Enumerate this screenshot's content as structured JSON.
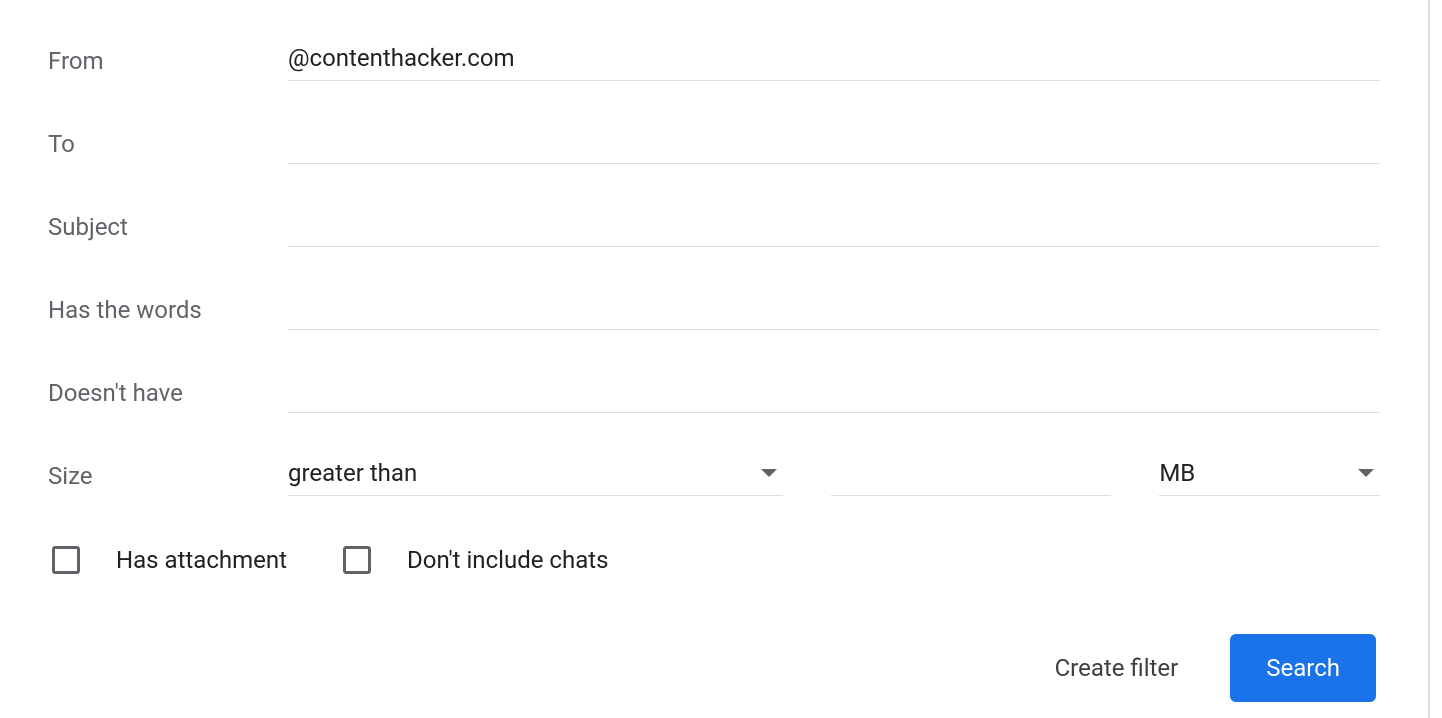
{
  "fields": {
    "from": {
      "label": "From",
      "value": "@contenthacker.com"
    },
    "to": {
      "label": "To",
      "value": ""
    },
    "subject": {
      "label": "Subject",
      "value": ""
    },
    "has_words": {
      "label": "Has the words",
      "value": ""
    },
    "doesnt_have": {
      "label": "Doesn't have",
      "value": ""
    }
  },
  "size": {
    "label": "Size",
    "comparator": "greater than",
    "value": "",
    "unit": "MB"
  },
  "checkboxes": {
    "has_attachment": {
      "label": "Has attachment",
      "checked": false
    },
    "exclude_chats": {
      "label": "Don't include chats",
      "checked": false
    }
  },
  "actions": {
    "create_filter": "Create filter",
    "search": "Search"
  }
}
